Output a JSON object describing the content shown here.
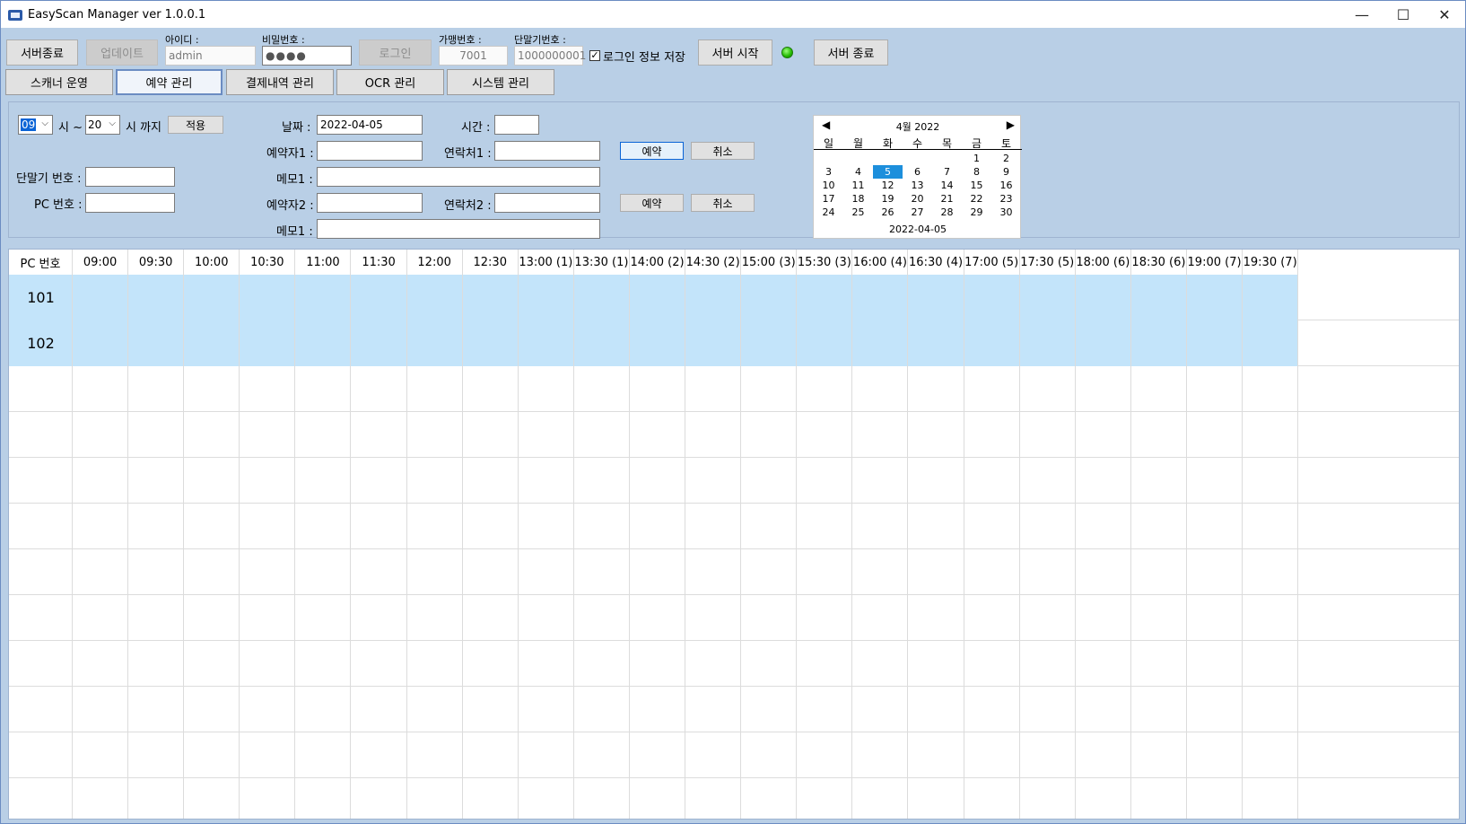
{
  "window": {
    "title": "EasyScan Manager ver 1.0.0.1",
    "min": "—",
    "max": "☐",
    "close": "✕"
  },
  "toolbar": {
    "server_exit": "서버종료",
    "update": "업데이트",
    "id_label": "아이디 :",
    "id_value": "admin",
    "pw_label": "비밀번호 :",
    "pw_value": "●●●●",
    "login": "로그인",
    "store_label": "가맹번호 :",
    "store_value": "7001",
    "terminal_label": "단말기번호 :",
    "terminal_value": "1000000001",
    "save_login_label": "로그인 정보 저장",
    "save_login_checked": "✓",
    "server_start": "서버 시작",
    "server_stop": "서버 종료",
    "status_color": "#22b800"
  },
  "tabs": [
    {
      "label": "스캐너 운영"
    },
    {
      "label": "예약 관리"
    },
    {
      "label": "결제내역 관리"
    },
    {
      "label": "OCR 관리"
    },
    {
      "label": "시스템 관리"
    }
  ],
  "filter": {
    "from_hour": "09",
    "from_suffix": "시 ~",
    "to_hour": "20",
    "to_suffix": "시 까지",
    "apply": "적용",
    "terminal_label": "단말기 번호 :",
    "pc_label": "PC 번호 :"
  },
  "reservation": {
    "date_label": "날짜 :",
    "date_value": "2022-04-05",
    "time_label": "시간 :",
    "reserver1_label": "예약자1 :",
    "contact1_label": "연락처1 :",
    "memo1_label": "메모1 :",
    "reserver2_label": "예약자2 :",
    "contact2_label": "연락처2 :",
    "memo2_label": "메모1 :",
    "reserve_btn": "예약",
    "cancel_btn": "취소"
  },
  "calendar": {
    "prev": "◀",
    "next": "▶",
    "month": "4월 2022",
    "weekdays": [
      "일",
      "월",
      "화",
      "수",
      "목",
      "금",
      "토"
    ],
    "weeks": [
      [
        "",
        "",
        "",
        "",
        "",
        "1",
        "2"
      ],
      [
        "3",
        "4",
        "5",
        "6",
        "7",
        "8",
        "9"
      ],
      [
        "10",
        "11",
        "12",
        "13",
        "14",
        "15",
        "16"
      ],
      [
        "17",
        "18",
        "19",
        "20",
        "21",
        "22",
        "23"
      ],
      [
        "24",
        "25",
        "26",
        "27",
        "28",
        "29",
        "30"
      ]
    ],
    "selected": "5",
    "today": "2022-04-05"
  },
  "schedule": {
    "pc_header": "PC 번호",
    "times": [
      "09:00",
      "09:30",
      "10:00",
      "10:30",
      "11:00",
      "11:30",
      "12:00",
      "12:30",
      "13:00 (1)",
      "13:30 (1)",
      "14:00 (2)",
      "14:30 (2)",
      "15:00 (3)",
      "15:30 (3)",
      "16:00 (4)",
      "16:30 (4)",
      "17:00 (5)",
      "17:30 (5)",
      "18:00 (6)",
      "18:30 (6)",
      "19:00 (7)",
      "19:30 (7)"
    ],
    "rows": [
      "101",
      "102"
    ],
    "row_color": "#c3e4fa"
  }
}
